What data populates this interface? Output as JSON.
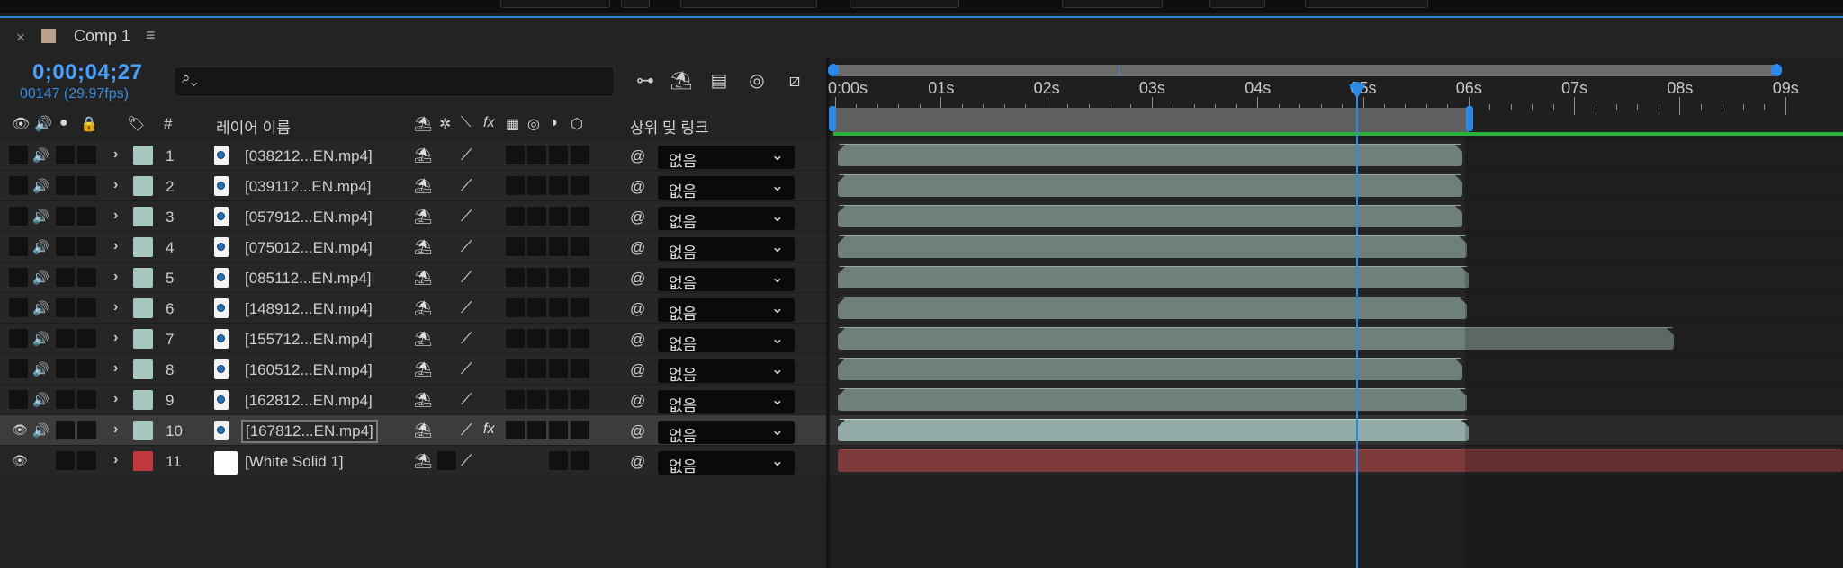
{
  "tab": {
    "title": "Comp 1",
    "close": "×",
    "menu": "≡"
  },
  "time": {
    "timecode": "0;00;04;27",
    "frames": "00147 (29.97fps)"
  },
  "columns": {
    "hash": "#",
    "layer_name": "레이어 이름",
    "parent": "상위 및 링크"
  },
  "ruler": {
    "ticks": [
      "0:00s",
      "01s",
      "02s",
      "03s",
      "04s",
      "05s",
      "06s",
      "07s",
      "08s",
      "09s"
    ]
  },
  "layers": [
    {
      "num": "1",
      "name": "[038212...EN.mp4]",
      "parent": "없음",
      "color": "#a9c7c1"
    },
    {
      "num": "2",
      "name": "[039112...EN.mp4]",
      "parent": "없음",
      "color": "#a9c7c1"
    },
    {
      "num": "3",
      "name": "[057912...EN.mp4]",
      "parent": "없음",
      "color": "#a9c7c1"
    },
    {
      "num": "4",
      "name": "[075012...EN.mp4]",
      "parent": "없음",
      "color": "#a9c7c1"
    },
    {
      "num": "5",
      "name": "[085112...EN.mp4]",
      "parent": "없음",
      "color": "#a9c7c1"
    },
    {
      "num": "6",
      "name": "[148912...EN.mp4]",
      "parent": "없음",
      "color": "#a9c7c1"
    },
    {
      "num": "7",
      "name": "[155712...EN.mp4]",
      "parent": "없음",
      "color": "#a9c7c1"
    },
    {
      "num": "8",
      "name": "[160512...EN.mp4]",
      "parent": "없음",
      "color": "#a9c7c1"
    },
    {
      "num": "9",
      "name": "[162812...EN.mp4]",
      "parent": "없음",
      "color": "#a9c7c1"
    },
    {
      "num": "10",
      "name": "[167812...EN.mp4]",
      "parent": "없음",
      "color": "#a9c7c1"
    },
    {
      "num": "11",
      "name": "[White Solid 1]",
      "parent": "없음",
      "color": "#c0383c"
    }
  ],
  "icons": {
    "search": "search-icon",
    "eye": "eye-icon",
    "audio": "speaker-icon",
    "solo": "solo-icon",
    "lock": "lock-icon",
    "label": "tag-icon",
    "expand": "chevron-right-icon",
    "shy": "shy-icon",
    "quality": "quality-slash-icon",
    "parent_pick": "pickwhip-icon",
    "dropdown": "chevron-down-icon"
  },
  "colors": {
    "accent": "#2b8ae8",
    "timecode": "#4aa0ff",
    "workarea": "#29b13a",
    "layer_bar": "#6f7f7b",
    "solid_bar": "#7c3a3a"
  }
}
